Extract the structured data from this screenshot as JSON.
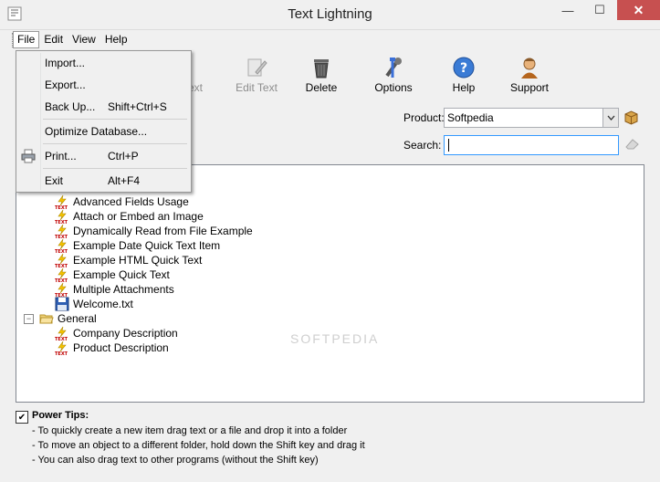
{
  "window": {
    "title": "Text Lightning",
    "minimize": "—",
    "maximize": "☐",
    "close": "✕"
  },
  "menubar": [
    "File",
    "Edit",
    "View",
    "Help"
  ],
  "toolbar": {
    "partial_label": "Text",
    "edit_text": "Edit Text",
    "delete": "Delete",
    "options": "Options",
    "help": "Help",
    "support": "Support"
  },
  "product": {
    "label": "Product:",
    "value": "Softpedia"
  },
  "search": {
    "label": "Search:",
    "value": ""
  },
  "tree": {
    "items": [
      "Advanced Fields Usage",
      "Attach or Embed an Image",
      "Dynamically Read from File Example",
      "Example Date Quick Text Item",
      "Example HTML Quick Text",
      "Example Quick Text",
      "Multiple Attachments",
      "Welcome.txt"
    ],
    "folder_general": "General",
    "general_items": [
      "Company Description",
      "Product Description"
    ]
  },
  "file_menu": {
    "import": "Import...",
    "export": "Export...",
    "backup": "Back Up...",
    "backup_shortcut": "Shift+Ctrl+S",
    "optimize": "Optimize Database...",
    "print": "Print...",
    "print_shortcut": "Ctrl+P",
    "exit": "Exit",
    "exit_shortcut": "Alt+F4"
  },
  "tips": {
    "title": "Power Tips:",
    "checked": true,
    "lines": [
      "- To quickly create a new item drag text or a file and drop it into a folder",
      "- To move an object to a different folder, hold down the Shift key and drag it",
      "- You can also drag text to other programs (without the Shift key)"
    ]
  },
  "watermark": "SOFTPEDIA"
}
